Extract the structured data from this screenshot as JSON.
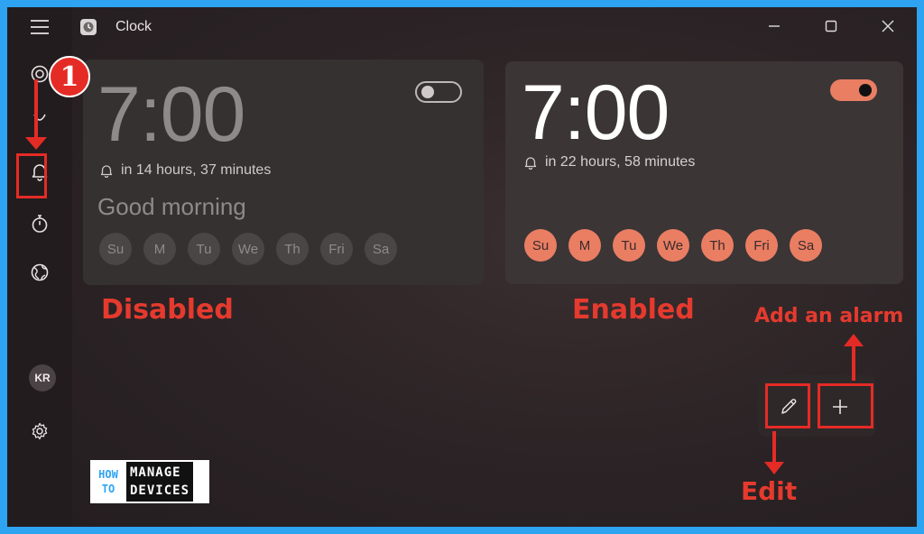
{
  "app": {
    "title": "Clock"
  },
  "sidebar": {
    "avatar_initials": "KR"
  },
  "alarms": [
    {
      "time": "7:00",
      "remaining": "in 14 hours, 37 minutes",
      "name": "Good morning",
      "days": [
        "Su",
        "M",
        "Tu",
        "We",
        "Th",
        "Fri",
        "Sa"
      ],
      "enabled": false
    },
    {
      "time": "7:00",
      "remaining": "in 22 hours, 58 minutes",
      "days": [
        "Su",
        "M",
        "Tu",
        "We",
        "Th",
        "Fri",
        "Sa"
      ],
      "enabled": true
    }
  ],
  "annotations": {
    "step_number": "1",
    "disabled_label": "Disabled",
    "enabled_label": "Enabled",
    "add_alarm_label": "Add an alarm",
    "edit_label": "Edit"
  },
  "logo": {
    "left_line1": "HOW",
    "left_line2": "TO",
    "right_line1": "MANAGE",
    "right_line2": "DEVICES"
  },
  "colors": {
    "accent": "#e97e63",
    "annotation_red": "#e52b26",
    "frame_blue": "#2ea3f2"
  },
  "icons": [
    "hamburger-icon",
    "focus-icon",
    "timer-icon",
    "alarm-bell-icon",
    "stopwatch-icon",
    "world-clock-icon",
    "settings-gear-icon",
    "edit-pencil-icon",
    "add-plus-icon"
  ]
}
